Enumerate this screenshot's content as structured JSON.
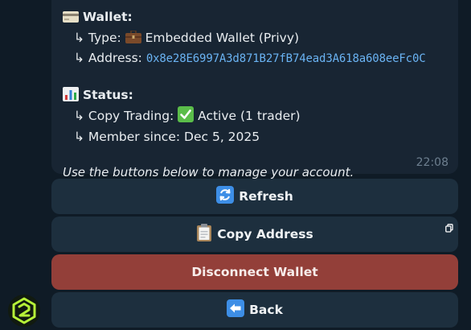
{
  "message": {
    "wallet_heading": "Wallet:",
    "type_label": "↳ Type:",
    "type_value": "Embedded Wallet (Privy)",
    "address_label": "↳ Address:",
    "address_value": "0x8e28E6997A3d871B27fB74ead3A618a608eeFc0C",
    "status_heading": "Status:",
    "copy_trading_label": "↳ Copy Trading:",
    "copy_trading_value": "Active (1 trader)",
    "member_since_label": "↳ Member since:",
    "member_since_value": "Dec 5, 2025",
    "footer_note": "Use the buttons below to manage your account.",
    "time": "22:08"
  },
  "buttons": {
    "refresh": "Refresh",
    "copy_address": "Copy Address",
    "disconnect": "Disconnect Wallet",
    "back": "Back"
  },
  "icons": {
    "wallet": "credit-card-icon",
    "type": "briefcase-icon",
    "status": "bar-chart-icon",
    "active": "check-mark-icon",
    "refresh": "refresh-arrows-icon",
    "copy": "clipboard-icon",
    "back": "left-arrow-icon",
    "avatar": "bot-logo-icon"
  },
  "colors": {
    "background": "#0f1b26",
    "bubble": "#182533",
    "button": "#1d2f3e",
    "danger_button": "#933f39",
    "link": "#6ab3f3",
    "check_green": "#5bbd4a",
    "logo_green": "#b6f238"
  }
}
